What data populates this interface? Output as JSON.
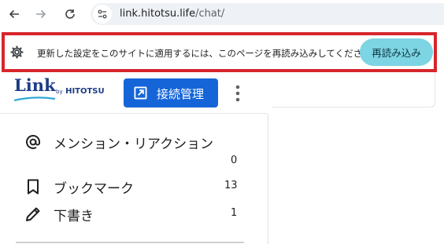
{
  "browser": {
    "url_host": "link.hitotsu.life",
    "url_path": "/chat/",
    "icons": {
      "back": "arrow-left-icon",
      "forward": "arrow-right-icon",
      "reload": "reload-icon",
      "site_info": "tune-icon"
    }
  },
  "infobar": {
    "message": "更新した設定をこのサイトに適用するには、このページを再読み込みしてください",
    "reload_label": "再読み込み",
    "icon": "gear-icon",
    "border_color": "#d6262c"
  },
  "header": {
    "logo": {
      "main": "Link",
      "by": "by",
      "brand": "HITOTSU"
    },
    "connect_label": "接続管理",
    "connect_color": "#1565d8"
  },
  "sidebar": {
    "items": [
      {
        "label": "メンション・リアクション",
        "count": "0",
        "icon": "at-icon"
      },
      {
        "label": "ブックマーク",
        "count": "13",
        "icon": "bookmark-icon"
      },
      {
        "label": "下書き",
        "count": "1",
        "icon": "pencil-icon"
      }
    ]
  }
}
